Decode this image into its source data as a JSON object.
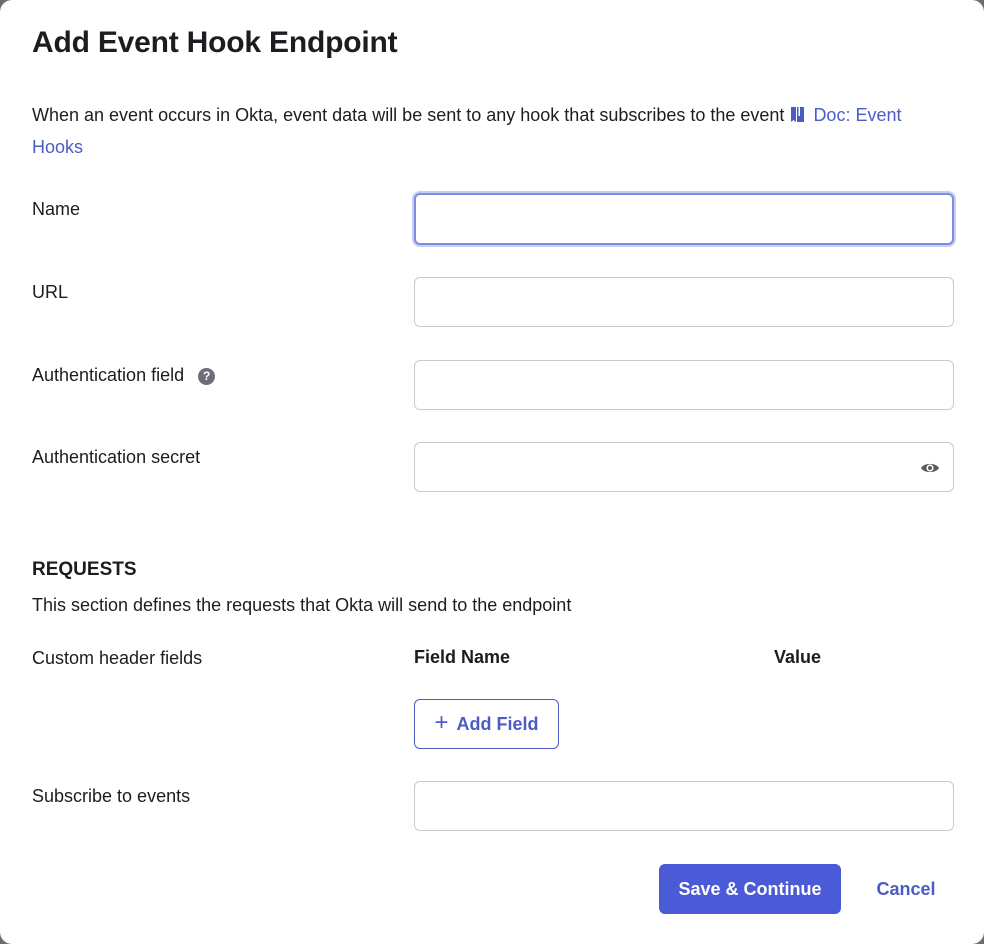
{
  "dialog": {
    "title": "Add Event Hook Endpoint",
    "description": "When an event occurs in Okta, event data will be sent to any hook that subscribes to the event",
    "doc_link": "Doc: Event Hooks",
    "doc_icon": "book-icon"
  },
  "fields": {
    "name": {
      "label": "Name",
      "value": ""
    },
    "url": {
      "label": "URL",
      "value": ""
    },
    "auth_field": {
      "label": "Authentication field",
      "value": "",
      "help_icon": "question-circle-icon"
    },
    "auth_secret": {
      "label": "Authentication secret",
      "value": "",
      "icon": "eye-icon"
    },
    "subscribe": {
      "label": "Subscribe to events",
      "value": ""
    }
  },
  "requests": {
    "heading": "REQUESTS",
    "description": "This section defines the requests that Okta will send to the endpoint",
    "custom_header_label": "Custom header fields",
    "col_field_name": "Field Name",
    "col_value": "Value",
    "add_field_label": "Add Field"
  },
  "actions": {
    "save_label": "Save & Continue",
    "cancel_label": "Cancel"
  },
  "colors": {
    "accent": "#4b5cc4",
    "primary_button": "#4b5ad6",
    "text": "#1d1d21",
    "border": "#c9cbd0"
  }
}
